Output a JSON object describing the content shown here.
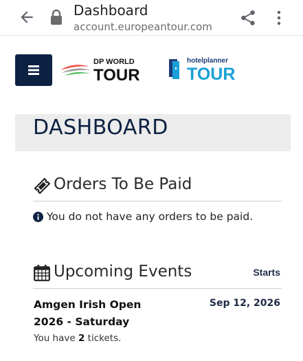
{
  "browser": {
    "title": "Dashboard",
    "url": "account.europeantour.com"
  },
  "header": {
    "logo_primary": "DP WORLD TOUR",
    "logo_secondary": "hotelplanner TOUR"
  },
  "dashboard": {
    "title": "DASHBOARD"
  },
  "orders": {
    "title": "Orders To Be Paid",
    "message": "You do not have any orders to be paid."
  },
  "events": {
    "title": "Upcoming Events",
    "starts_label": "Starts",
    "items": [
      {
        "name": "Amgen Irish Open 2026 - Saturday",
        "date": "Sep 12, 2026",
        "tickets_prefix": "You have ",
        "tickets_count": "2",
        "tickets_suffix": " tickets."
      }
    ]
  },
  "colors": {
    "navy": "#0d2142",
    "panel_grey": "#ececec",
    "hp_blue": "#1aa0d8"
  }
}
